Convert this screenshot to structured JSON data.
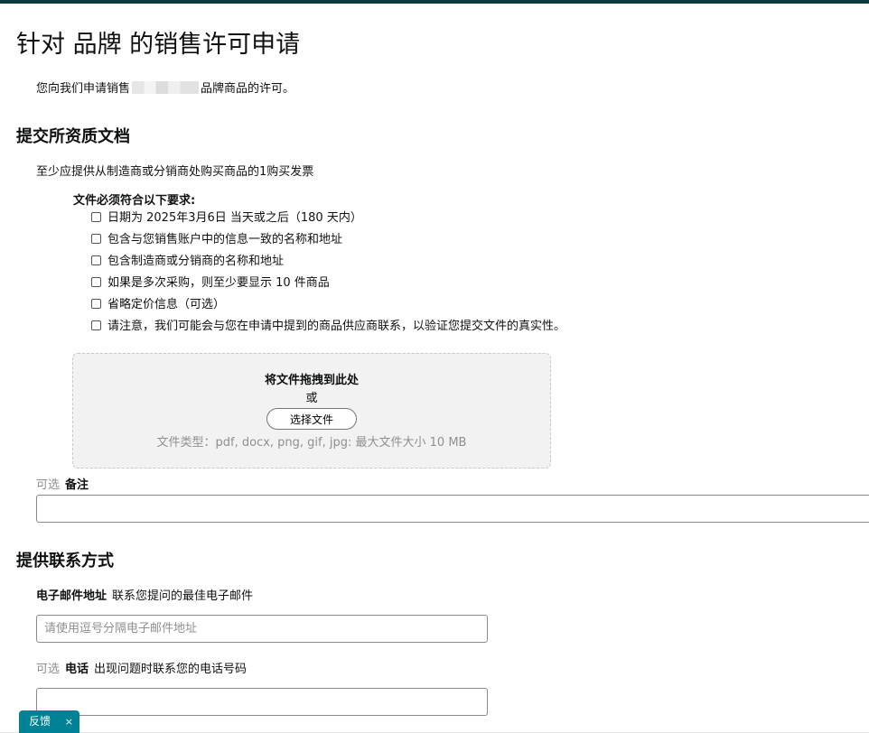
{
  "page": {
    "title": "针对 品牌 的销售许可申请",
    "intro_prefix": "您向我们申请销售",
    "intro_suffix": "品牌商品的许可。"
  },
  "documents": {
    "heading": "提交所资质文档",
    "description": "至少应提供从制造商或分销商处购买商品的1购买发票",
    "requirements_title": "文件必须符合以下要求:",
    "requirements": [
      {
        "label": "日期为 2025年3月6日 当天或之后（180 天内）"
      },
      {
        "label": "包含与您销售账户中的信息一致的名称和地址"
      },
      {
        "label": "包含制造商或分销商的名称和地址"
      },
      {
        "label": "如果是多次采购，则至少要显示 10 件商品"
      },
      {
        "label": "省略定价信息（可选）"
      },
      {
        "label": "请注意，我们可能会与您在申请中提到的商品供应商联系，以验证您提交文件的真实性。"
      }
    ],
    "dropzone": {
      "title": "将文件拖拽到此处",
      "or": "或",
      "choose_button": "选择文件",
      "file_types": "文件类型：pdf, docx, png, gif, jpg: 最大文件大小 10 MB"
    },
    "notes": {
      "optional": "可选",
      "label": "备注",
      "value": ""
    }
  },
  "contact": {
    "heading": "提供联系方式",
    "email": {
      "label": "电子邮件地址",
      "hint": "联系您提问的最佳电子邮件",
      "placeholder": "请使用逗号分隔电子邮件地址",
      "value": ""
    },
    "phone": {
      "optional": "可选",
      "label": "电话",
      "hint": "出现问题时联系您的电话号码",
      "value": ""
    }
  },
  "feedback": {
    "label": "反馈",
    "close": "×"
  },
  "colors": {
    "topbar": "#0b3b3a",
    "feedback_bg": "#008296",
    "muted_text": "#8e9090"
  }
}
